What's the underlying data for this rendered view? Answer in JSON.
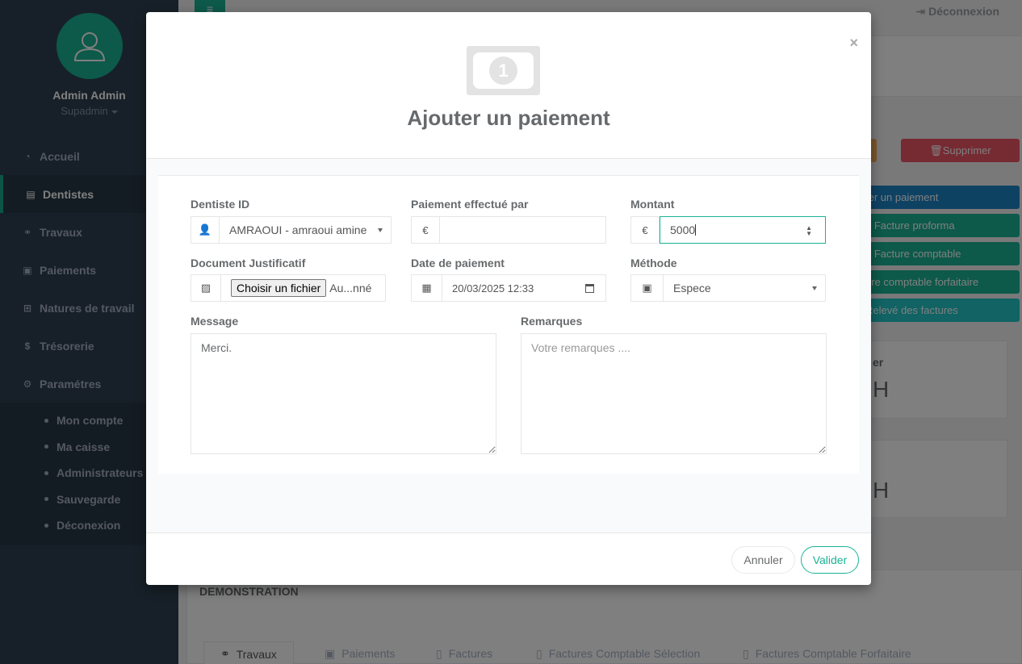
{
  "sidebar": {
    "user_name": "Admin Admin",
    "user_role": "Supadmin",
    "items": [
      {
        "label": "Accueil",
        "icon": "dashboard-icon"
      },
      {
        "label": "Dentistes",
        "icon": "id-card-icon"
      },
      {
        "label": "Travaux",
        "icon": "handshake-icon"
      },
      {
        "label": "Paiements",
        "icon": "money-icon"
      },
      {
        "label": "Natures de travail",
        "icon": "sitemap-icon"
      },
      {
        "label": "Trésorerie",
        "icon": "dollar-icon"
      },
      {
        "label": "Paramétres",
        "icon": "gears-icon"
      }
    ],
    "subitems": [
      "Mon compte",
      "Ma caisse",
      "Administrateurs",
      "Sauvegarde",
      "Déconexion"
    ]
  },
  "topbar": {
    "logout": "Déconnexion"
  },
  "background": {
    "delete_button": "Supprimer",
    "actions": [
      "ter un paiement",
      "e Facture proforma",
      "e Facture comptable",
      "ure comptable forfaitaire",
      "Relevé des factures"
    ],
    "card1_label": "er",
    "card1_value": "H",
    "card2_value": "H",
    "section_title": "DEMONSTRATION",
    "tabs": [
      "Travaux",
      "Paiements",
      "Factures",
      "Factures Comptable Sélection",
      "Factures Comptable Forfaitaire"
    ]
  },
  "modal": {
    "icon": "money-icon",
    "title": "Ajouter un paiement",
    "close": "×",
    "fields": {
      "dentist": {
        "label": "Dentiste ID",
        "value": "AMRAOUI - amraoui amine"
      },
      "paid_by": {
        "label": "Paiement effectué par",
        "addon": "€",
        "value": ""
      },
      "amount": {
        "label": "Montant",
        "addon": "€",
        "value": "5000"
      },
      "document": {
        "label": "Document Justificatif",
        "button": "Choisir un fichier",
        "file_text": "Au...nné"
      },
      "date": {
        "label": "Date de paiement",
        "value": "20/03/2025 12:33"
      },
      "method": {
        "label": "Méthode",
        "value": "Espece"
      },
      "message": {
        "label": "Message",
        "value": "Merci."
      },
      "remarks": {
        "label": "Remarques",
        "placeholder": "Votre remarques ...."
      }
    },
    "footer": {
      "cancel": "Annuler",
      "submit": "Valider"
    }
  },
  "colors": {
    "primary": "#1ab394",
    "sidebar": "#2f4050",
    "danger": "#ed5565",
    "info": "#1c84c6",
    "teal": "#23c6c8"
  }
}
